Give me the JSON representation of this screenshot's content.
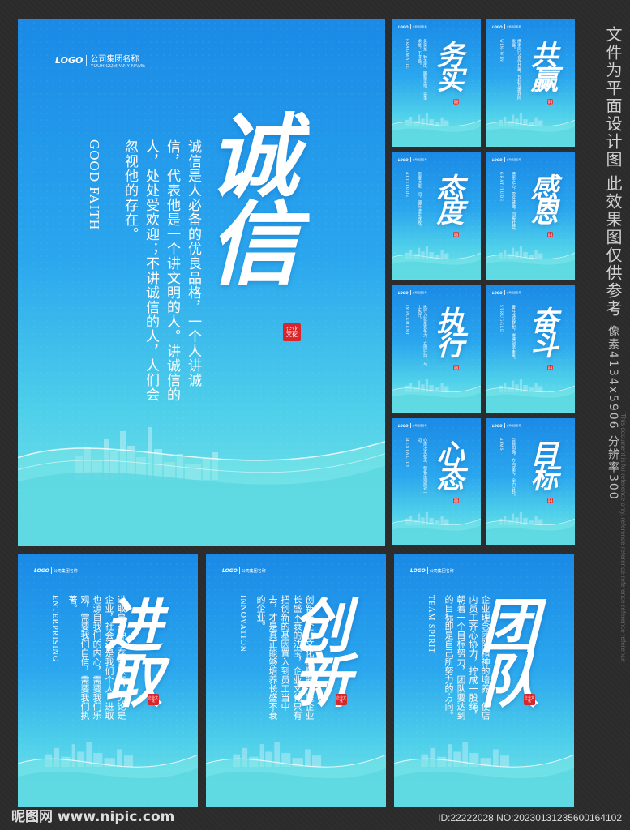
{
  "side_note": {
    "line1": "文件为平面设计图",
    "line2": "此效果图仅供参考",
    "pixel_info": "像素4134x5906 分辨率300"
  },
  "watermark_text": "This document is for reference only. reference reference reference reference reference",
  "footer": {
    "site": "昵图网 www.nipic.com",
    "id": "ID:22222028 NO:20230131235600164102"
  },
  "logo": {
    "mark": "LOGO",
    "cn": "公司集团名称",
    "en": "YOUR COMPANY NAME"
  },
  "seal_text": "企业文化",
  "main_poster": {
    "title": "诚信",
    "english": "GOOD FAITH",
    "body": "诚信是人必备的优良品格，一个人讲诚信，代表他是一个讲文明的人。讲诚信的人，处处受欢迎；不讲诚信的人，人们会忽视他的存在。"
  },
  "small_posters": [
    {
      "title": "务实",
      "english": "PRAGMATIC",
      "body": "务实是一种态度，脚踏实地，实事求是，不浮躁。"
    },
    {
      "title": "共赢",
      "english": "WIN-WIN",
      "body": "携手同行合作共赢，互利互惠共同发展。"
    },
    {
      "title": "态度",
      "english": "ATTITUDE",
      "body": "态度决定一切，细节决定成败。"
    },
    {
      "title": "感恩",
      "english": "GRATITUDE",
      "body": "感恩之心，常怀感激，回报社会。"
    },
    {
      "title": "执行",
      "english": "IMPLEMENT",
      "body": "执行力就是竞争力，立即行动，马上执行。"
    },
    {
      "title": "奋斗",
      "english": "STRUGGLE",
      "body": "奋斗成就梦想，拼搏创造未来。"
    },
    {
      "title": "心态",
      "english": "MENTALITY",
      "body": "心态决定状态，积极乐观面对一切。"
    },
    {
      "title": "目标",
      "english": "AIMS",
      "body": "目标明确，方向坚定，全力以赴。"
    }
  ],
  "bottom_posters": [
    {
      "title": "进取",
      "english": "ENTERPRISING",
      "body": "进取是一种生存的状态，无论是企业，社会还是我们个人，进取也源自我们的内心，需要我们乐观，需要我们自信，需要我们执著。"
    },
    {
      "title": "创新",
      "english": "INNOVATION",
      "body": "创新是企业文化的精髓，是企业长盛不衰的法宝，企业文化只有把创新的基因置入到员工当中去，才是真正能够培养长盛不衰的企业。"
    },
    {
      "title": "团队",
      "english": "TEAM SPIRIT",
      "body": "企业理念团队精神的培养，使店内员工齐心协力，拧成一股绳，朝着一个目标努力，团队要达到的目标即是自己所努力的方向。"
    }
  ]
}
